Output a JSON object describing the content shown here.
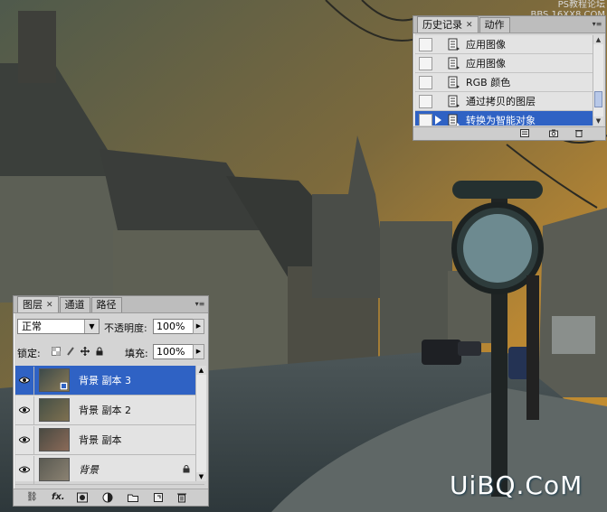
{
  "watermark": {
    "top_line1": "PS教程论坛",
    "top_line2": "BBS.16XX8.COM",
    "bottom": "UiBQ.CoM"
  },
  "history_panel": {
    "tabs": [
      {
        "label": "历史记录",
        "active": true
      },
      {
        "label": "动作",
        "active": false
      }
    ],
    "items": [
      {
        "label": "应用图像",
        "selected": false
      },
      {
        "label": "应用图像",
        "selected": false
      },
      {
        "label": "RGB 颜色",
        "selected": false
      },
      {
        "label": "通过拷贝的图层",
        "selected": false
      },
      {
        "label": "转换为智能对象",
        "selected": true
      }
    ]
  },
  "layers_panel": {
    "tabs": [
      {
        "label": "图层",
        "active": true
      },
      {
        "label": "通道",
        "active": false
      },
      {
        "label": "路径",
        "active": false
      }
    ],
    "blend_mode": "正常",
    "opacity_label": "不透明度:",
    "opacity_value": "100%",
    "lock_label": "锁定:",
    "fill_label": "填充:",
    "fill_value": "100%",
    "layers": [
      {
        "name": "背景 副本 3",
        "selected": true,
        "smart_object": true
      },
      {
        "name": "背景 副本 2",
        "selected": false
      },
      {
        "name": "背景 副本",
        "selected": false
      },
      {
        "name": "背景",
        "selected": false,
        "locked": true,
        "italic": true
      }
    ],
    "bottom_icons": [
      "link-icon",
      "fx-icon",
      "mask-icon",
      "adjustment-icon",
      "folder-icon",
      "new-layer-icon",
      "trash-icon"
    ]
  },
  "colors": {
    "selection": "#2f62c4",
    "panel_bg": "#d4d4d4",
    "sky_orange": "#c58a3a",
    "dusk_teal": "#3f5a5c"
  }
}
